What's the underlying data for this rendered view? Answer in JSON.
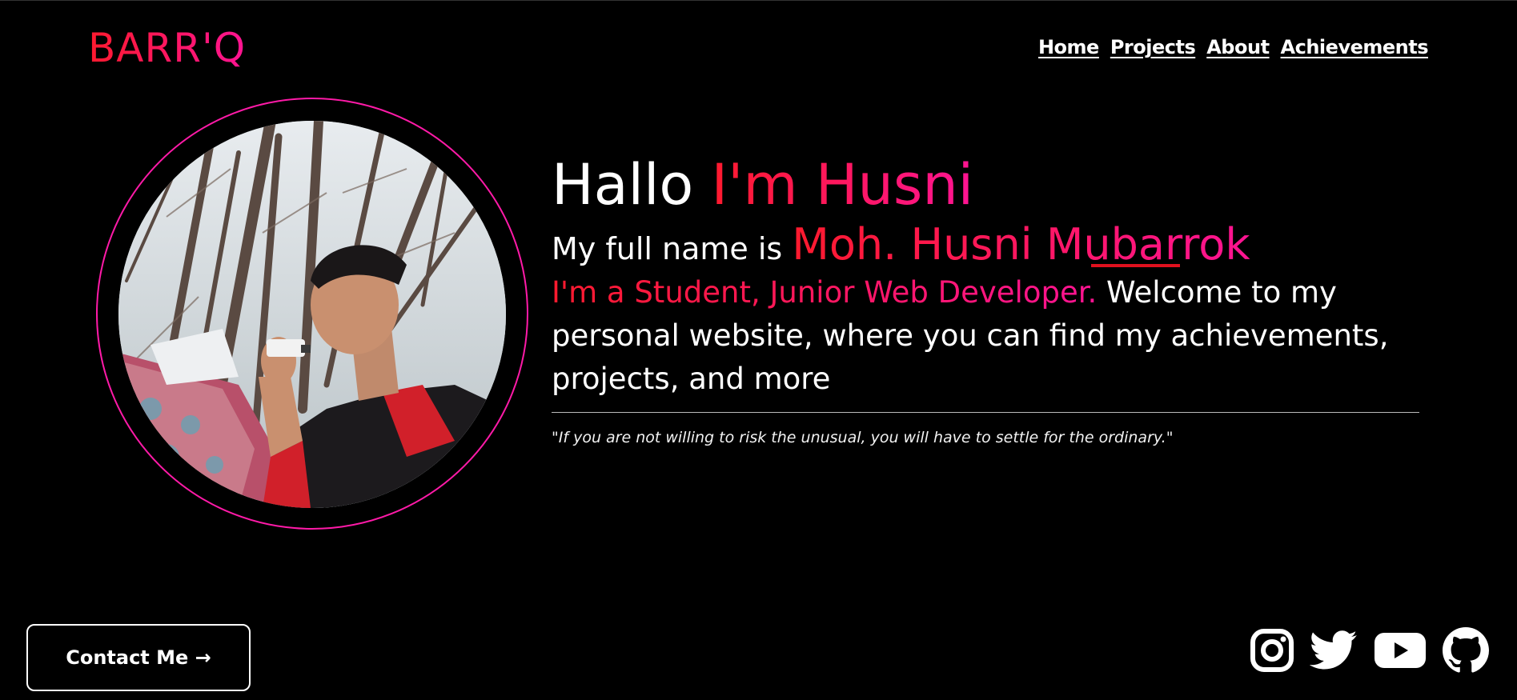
{
  "logo": {
    "text": "BARR'Q"
  },
  "nav": {
    "items": [
      {
        "label": "Home"
      },
      {
        "label": "Projects"
      },
      {
        "label": "About"
      },
      {
        "label": "Achievements"
      }
    ]
  },
  "hero": {
    "greeting": "Hallo ",
    "name_short": "I'm Husni",
    "fullname_prefix": "My full name is ",
    "fullname": "Moh. Husni Mubarrok",
    "role": "I'm a Student, Junior Web Developer.",
    "welcome": " Welcome to my personal website, where you can find my achievements, projects, and more",
    "quote": "\"If you are not willing to risk the unusual, you will have to settle for the ordinary.\""
  },
  "contact": {
    "label": "Contact Me →"
  },
  "socials": [
    {
      "icon": "instagram-icon"
    },
    {
      "icon": "twitter-icon"
    },
    {
      "icon": "youtube-icon"
    },
    {
      "icon": "github-icon"
    }
  ],
  "colors": {
    "background": "#000000",
    "accent_start": "#ff1a2e",
    "accent_end": "#ff1493",
    "ring": "#ff1aa8"
  }
}
